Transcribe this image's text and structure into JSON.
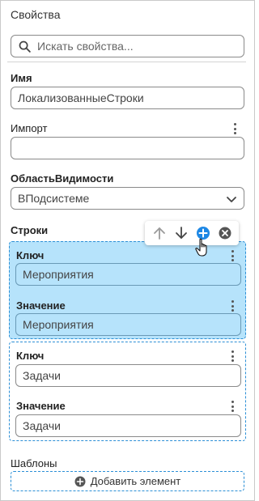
{
  "panel": {
    "title": "Свойства"
  },
  "search": {
    "placeholder": "Искать свойства..."
  },
  "name": {
    "label": "Имя",
    "value": "ЛокализованныеСтроки"
  },
  "import": {
    "label": "Импорт",
    "value": ""
  },
  "scope": {
    "label": "ОбластьВидимости",
    "value": "ВПодсистеме"
  },
  "strings": {
    "label": "Строки",
    "items": [
      {
        "key_label": "Ключ",
        "key_value": "Мероприятия",
        "value_label": "Значение",
        "value_value": "Мероприятия"
      },
      {
        "key_label": "Ключ",
        "key_value": "Задачи",
        "value_label": "Значение",
        "value_value": "Задачи"
      }
    ]
  },
  "templates": {
    "label": "Шаблоны",
    "add_label": "Добавить элемент"
  },
  "colors": {
    "accent": "#1e88e5",
    "selected_bg": "#b6e3fb",
    "dashed_border": "#2b8fd6"
  }
}
